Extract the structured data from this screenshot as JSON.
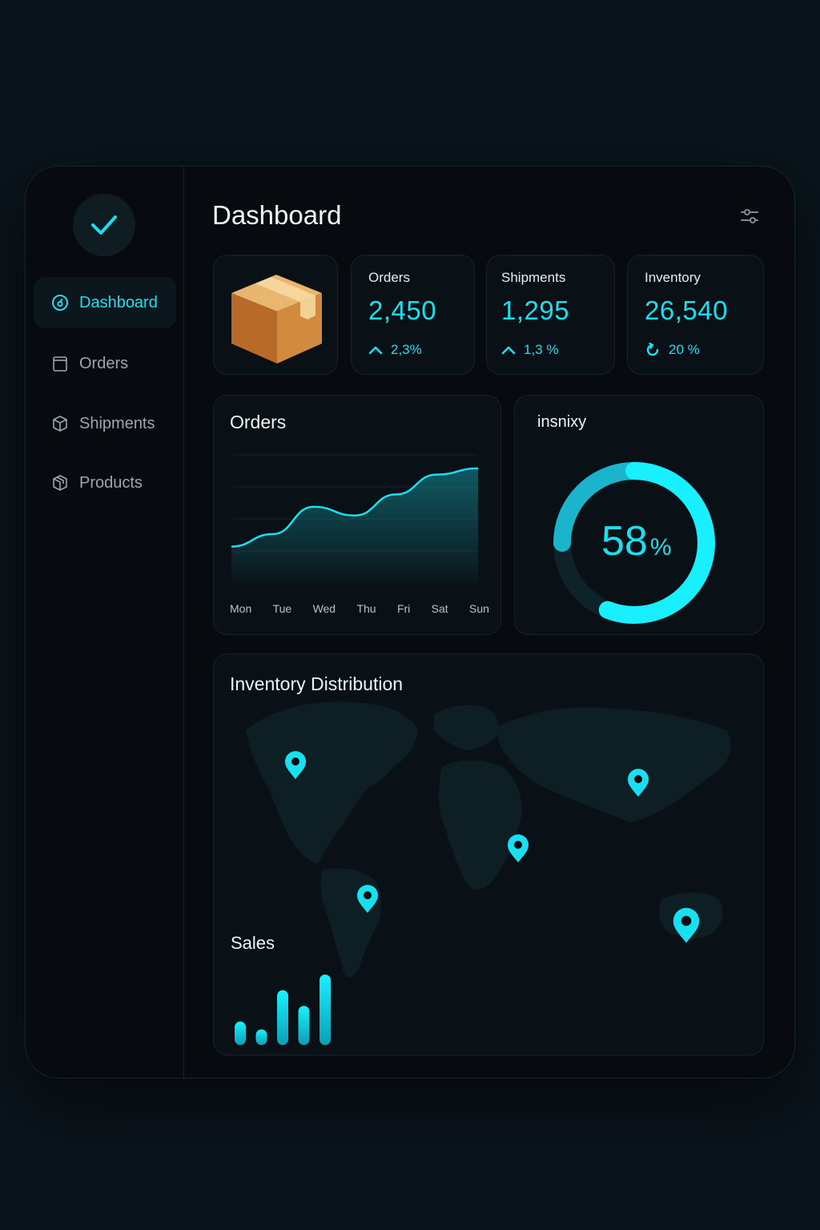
{
  "sidebar": {
    "items": [
      {
        "label": "Dashboard",
        "icon": "dashboard-icon",
        "active": true
      },
      {
        "label": "Orders",
        "icon": "clipboard-icon",
        "active": false
      },
      {
        "label": "Shipments",
        "icon": "box-icon",
        "active": false
      },
      {
        "label": "Products",
        "icon": "package-icon",
        "active": false
      }
    ]
  },
  "header": {
    "title": "Dashboard"
  },
  "stats": [
    {
      "label": "Orders",
      "value": "2,450",
      "change": "2,3%",
      "icon": "arrow-up-icon"
    },
    {
      "label": "Shipments",
      "value": "1,295",
      "change": "1,3 %",
      "icon": "arrow-up-icon"
    },
    {
      "label": "Inventory",
      "value": "26,540",
      "change": "20 %",
      "icon": "refresh-icon"
    }
  ],
  "orders_chart": {
    "title": "Orders",
    "days": [
      "Mon",
      "Tue",
      "Wed",
      "Thu",
      "Fri",
      "Sat",
      "Sun"
    ]
  },
  "donut": {
    "title": "insnixy",
    "value": "58",
    "unit": "%",
    "percent": 58
  },
  "map": {
    "title": "Inventory Distribution",
    "sales_title": "Sales",
    "sales_bars": [
      3,
      2,
      7,
      5,
      9
    ]
  },
  "colors": {
    "accent": "#19e0f0",
    "background": "#070b0f",
    "card": "#0a1116"
  },
  "chart_data": {
    "type": "area",
    "title": "Orders",
    "categories": [
      "Mon",
      "Tue",
      "Wed",
      "Thu",
      "Fri",
      "Sat",
      "Sun"
    ],
    "values": [
      30,
      40,
      62,
      55,
      72,
      88,
      93
    ],
    "ylim": [
      0,
      100
    ]
  }
}
